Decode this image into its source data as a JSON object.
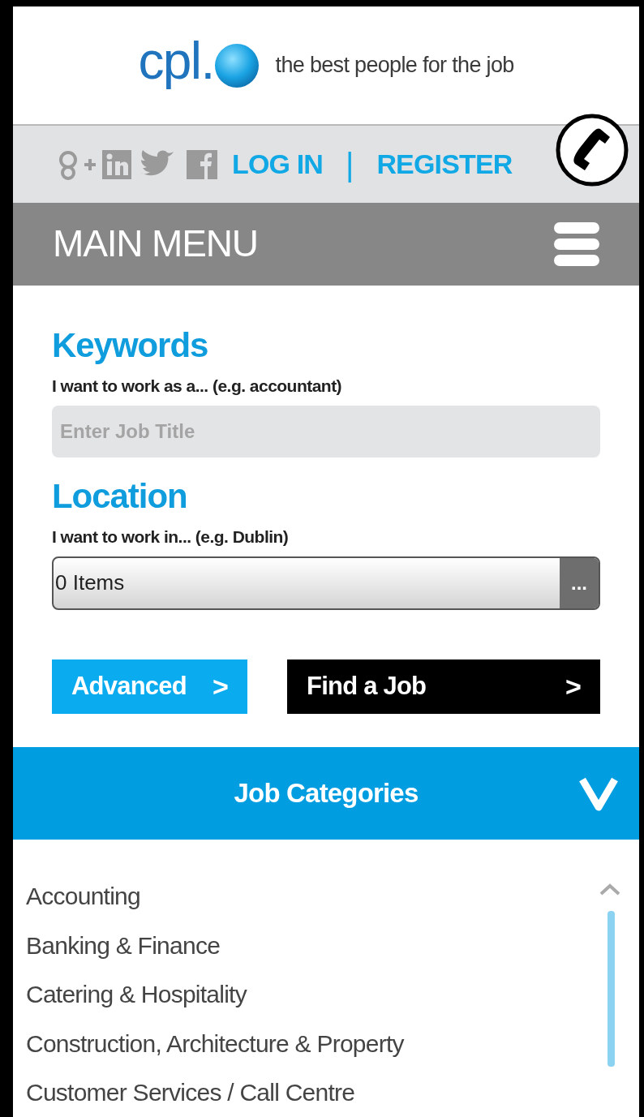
{
  "header": {
    "logo_text": "cpl.",
    "tagline": "the best people for the job"
  },
  "account_bar": {
    "links": [
      "LOG IN",
      "REGISTER"
    ],
    "separator": "|"
  },
  "main_menu": {
    "title": "MAIN MENU"
  },
  "search": {
    "keywords_heading": "Keywords",
    "keywords_label": "I want to work as a... (e.g. accountant)",
    "keywords_placeholder": "Enter Job Title",
    "location_heading": "Location",
    "location_label": "I want to work in... (e.g. Dublin)",
    "location_value": "0 Items",
    "location_button": "...",
    "buttons": [
      {
        "label": "Advanced",
        "kind": "secondary",
        "icon": ">"
      },
      {
        "label": "Find a Job",
        "kind": "primary",
        "icon": ">"
      }
    ]
  },
  "job_categories": {
    "title": "Job Categories",
    "expanded": true,
    "items": [
      "Accounting",
      "Banking & Finance",
      "Catering & Hospitality",
      "Construction, Architecture & Property",
      "Customer Services / Call Centre"
    ]
  }
}
